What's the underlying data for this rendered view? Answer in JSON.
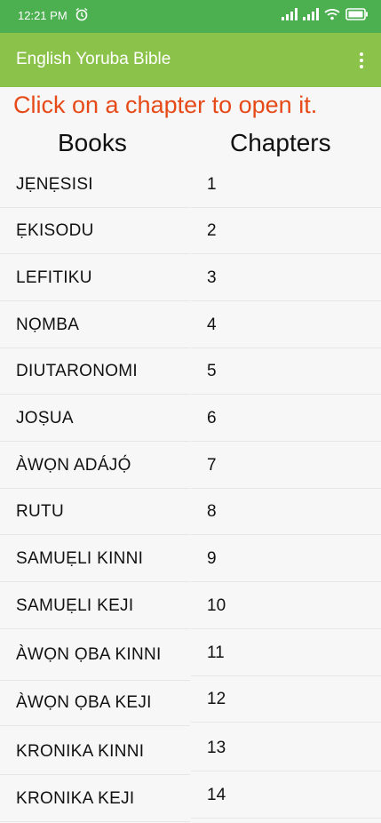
{
  "status_bar": {
    "time": "12:21 PM",
    "icons": [
      "alarm-icon",
      "signal-icon",
      "signal-icon",
      "wifi-icon",
      "battery-icon"
    ],
    "color": "#4caf50"
  },
  "app_bar": {
    "title": "English Yoruba Bible",
    "menu_icon": "more-vert-icon",
    "color": "#8bc34a"
  },
  "instruction": "Click on a chapter to open it.",
  "instruction_color": "#e64a19",
  "headers": {
    "books": "Books",
    "chapters": "Chapters"
  },
  "rows": [
    {
      "book": "JẸNẸSISI",
      "chapter": "1"
    },
    {
      "book": "ẸKISODU",
      "chapter": "2"
    },
    {
      "book": "LEFITIKU",
      "chapter": "3"
    },
    {
      "book": "NỌMBA",
      "chapter": "4"
    },
    {
      "book": "DIUTARONOMI",
      "chapter": "5"
    },
    {
      "book": "JOṢUA",
      "chapter": "6"
    },
    {
      "book": "ÀWỌN ADÁJỌ́",
      "chapter": "7"
    },
    {
      "book": "RUTU",
      "chapter": "8"
    },
    {
      "book": "SAMUẸLI KINNI",
      "chapter": "9"
    },
    {
      "book": "SAMUẸLI KEJI",
      "chapter": "10"
    },
    {
      "book": "ÀWỌN ỌBA KINNI",
      "chapter": "11"
    },
    {
      "book": "ÀWỌN ỌBA KEJI",
      "chapter": "12"
    },
    {
      "book": "KRONIKA KINNI",
      "chapter": "13"
    },
    {
      "book": "KRONIKA KEJI",
      "chapter": "14"
    }
  ]
}
